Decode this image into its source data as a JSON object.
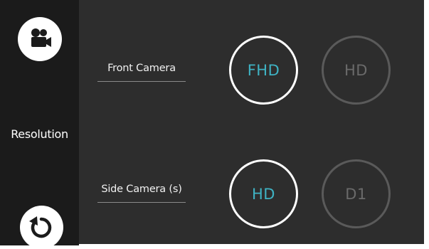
{
  "sidebar": {
    "top_icon": "video-camera-icon",
    "label": "Resolution",
    "bottom_icon": "reset-icon"
  },
  "front_camera": {
    "label": "Front Camera",
    "options": [
      {
        "label": "FHD",
        "selected": true
      },
      {
        "label": "HD",
        "selected": false
      }
    ]
  },
  "side_camera": {
    "label": "Side Camera (s)",
    "options": [
      {
        "label": "HD",
        "selected": true
      },
      {
        "label": "D1",
        "selected": false
      }
    ]
  },
  "colors": {
    "accent": "#3fb3c4",
    "sidebar_bg": "#1b1b1b",
    "panel_bg": "#2d2d2d",
    "unselected_ring": "#5a5a5a"
  }
}
